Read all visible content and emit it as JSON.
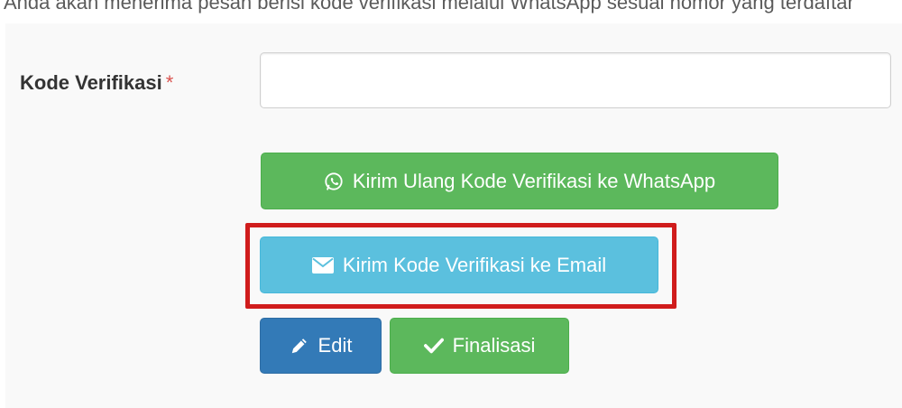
{
  "top_text": "Anda akan menerima pesan berisi kode verifikasi melalui WhatsApp sesuai nomor yang terdaftar",
  "form": {
    "label": "Kode Verifikasi",
    "required_marker": "*",
    "input_value": "",
    "input_placeholder": ""
  },
  "buttons": {
    "whatsapp": {
      "label": "Kirim Ulang Kode Verifikasi ke WhatsApp",
      "icon": "whatsapp-icon"
    },
    "email": {
      "label": "Kirim Kode Verifikasi ke Email",
      "icon": "envelope-icon"
    },
    "edit": {
      "label": "Edit",
      "icon": "pencil-icon"
    },
    "finalize": {
      "label": "Finalisasi",
      "icon": "checkmark-icon"
    }
  },
  "colors": {
    "success": "#5cb85c",
    "info": "#5bc0de",
    "primary": "#337ab7",
    "required": "#d9534f",
    "highlight": "#d01c1c"
  }
}
